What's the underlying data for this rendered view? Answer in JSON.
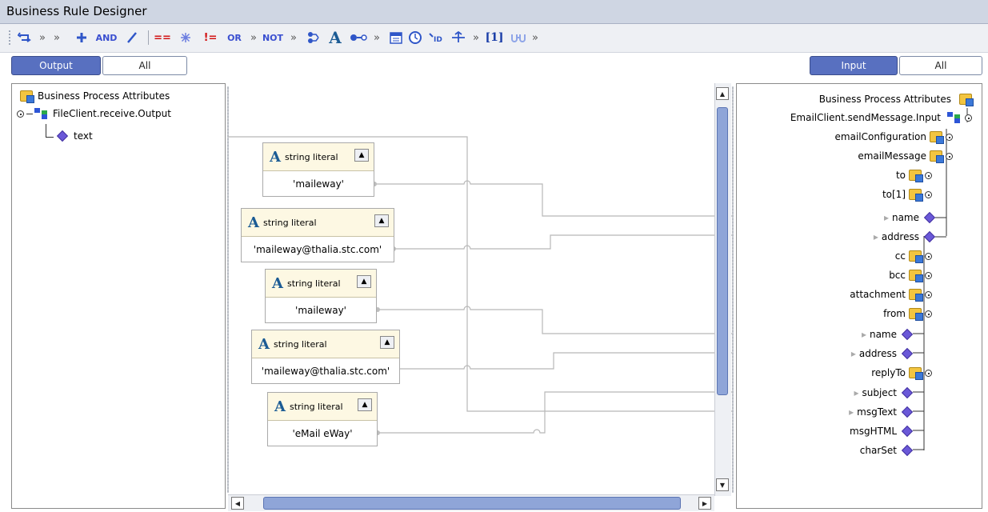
{
  "window": {
    "title": "Business Rule Designer"
  },
  "toolbar": {
    "and_label": "AND",
    "or_label": "OR",
    "not_label": "NOT",
    "index_label": "[1]",
    "neq_label": "!=",
    "eq_label": "==",
    "chevron": "»"
  },
  "left_tabs": {
    "output": "Output",
    "all": "All"
  },
  "right_tabs": {
    "input": "Input",
    "all": "All"
  },
  "left_tree": {
    "root": "Business Process Attributes",
    "node": "FileClient.receive.Output",
    "leaf": "text"
  },
  "literals": [
    {
      "type": "string literal",
      "value": "'maileway'"
    },
    {
      "type": "string literal",
      "value": "'maileway@thalia.stc.com'"
    },
    {
      "type": "string literal",
      "value": "'maileway'"
    },
    {
      "type": "string literal",
      "value": "'maileway@thalia.stc.com'"
    },
    {
      "type": "string literal",
      "value": "'eMail eWay'"
    }
  ],
  "right_tree": {
    "root": "Business Process Attributes",
    "node": "EmailClient.sendMessage.Input",
    "items": [
      "emailConfiguration",
      "emailMessage",
      "to",
      "to[1]",
      "name",
      "address",
      "cc",
      "bcc",
      "attachment",
      "from",
      "name",
      "address",
      "replyTo",
      "subject",
      "msgText",
      "msgHTML",
      "charSet"
    ]
  }
}
